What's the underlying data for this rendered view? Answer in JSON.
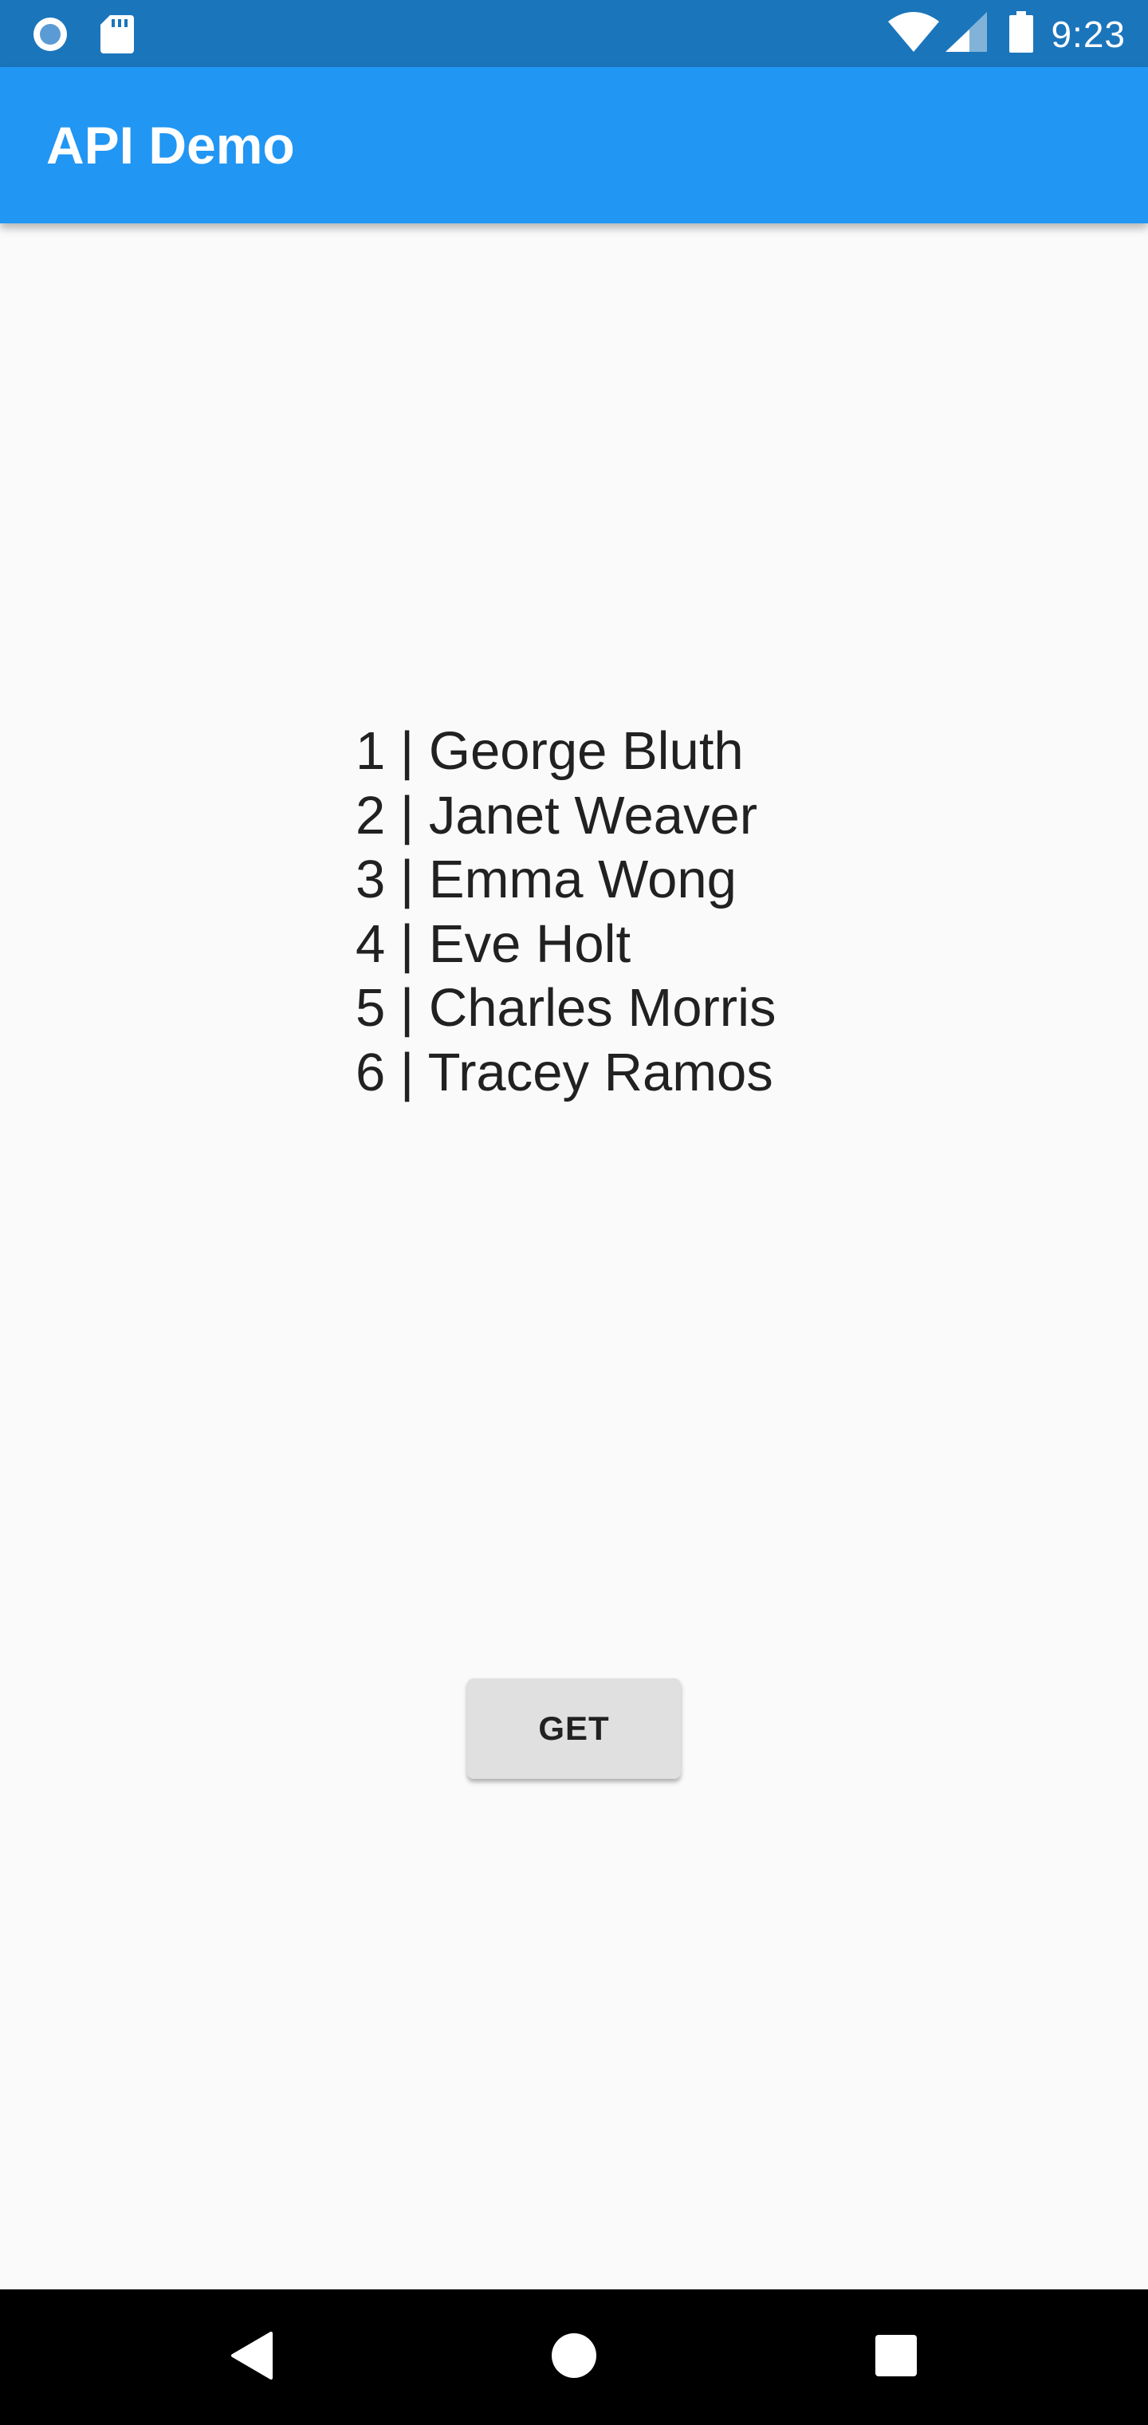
{
  "status_bar": {
    "time": "9:23",
    "left_icons": [
      "notification-circle-icon",
      "sd-card-icon"
    ],
    "right_icons": [
      "wifi-icon",
      "cell-signal-icon",
      "battery-icon"
    ]
  },
  "app_bar": {
    "title": "API Demo",
    "color": "#2196f3"
  },
  "users": [
    {
      "id": "1",
      "name": "George Bluth",
      "label": "1 | George Bluth"
    },
    {
      "id": "2",
      "name": "Janet Weaver",
      "label": "2 | Janet Weaver"
    },
    {
      "id": "3",
      "name": "Emma Wong",
      "label": "3 | Emma Wong"
    },
    {
      "id": "4",
      "name": "Eve Holt",
      "label": "4 | Eve Holt"
    },
    {
      "id": "5",
      "name": "Charles Morris",
      "label": "5 | Charles Morris"
    },
    {
      "id": "6",
      "name": "Tracey Ramos",
      "label": "6 | Tracey Ramos"
    }
  ],
  "actions": {
    "get_label": "GET"
  },
  "nav_bar": {
    "icons": [
      "back-icon",
      "home-icon",
      "recents-icon"
    ]
  }
}
